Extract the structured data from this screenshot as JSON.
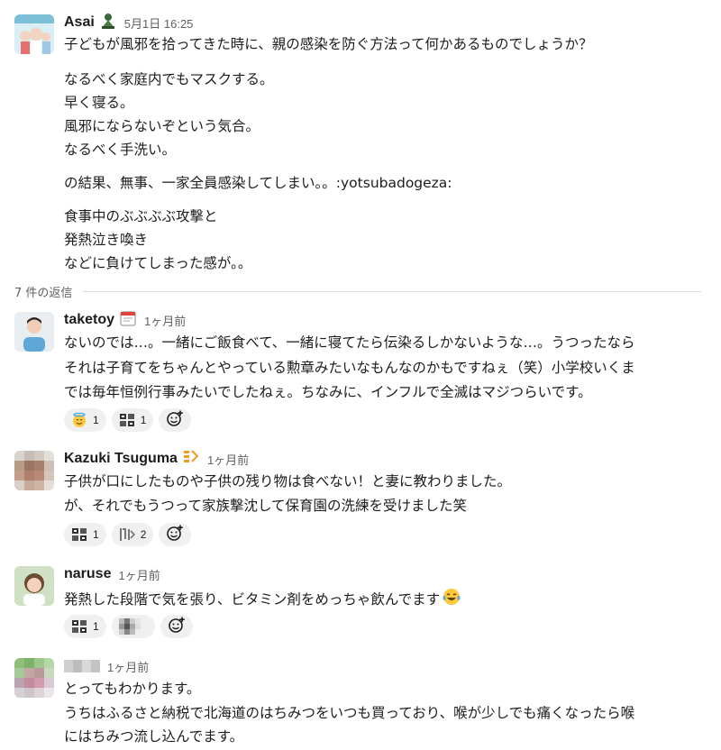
{
  "thread": {
    "parent": {
      "author": "Asai",
      "timestamp": "5月1日 16:25",
      "lines": [
        "子どもが風邪を拾ってきた時に、親の感染を防ぐ方法って何かあるものでしょうか？",
        "なるべく家庭内でもマスクする。",
        "早く寝る。",
        "風邪にならないぞという気合。",
        "なるべく手洗い。",
        "の結果、無事、一家全員感染してしまい。。:yotsubadogeza:",
        "食事中のぶぶぶぶ攻撃と",
        "発熱泣き喚き",
        "などに負けてしまった感が。。"
      ]
    },
    "replies_label": "7 件の返信",
    "replies": [
      {
        "author": "taketoy",
        "timestamp": "1ヶ月前",
        "lines": [
          "ないのでは…。一緒にご飯食べて、一緒に寝てたら伝染るしかないような…。うつったなら",
          "それは子育てをちゃんとやっている勲章みたいなもんなのかもですねぇ（笑）小学校いくま",
          "では毎年恒例行事みたいでしたねぇ。ちなみに、インフルで全滅はマジつらいです。"
        ],
        "reactions": [
          {
            "icon": "innocent-face-icon",
            "count": "1"
          },
          {
            "icon": "custom-stamp-icon",
            "count": "1"
          }
        ]
      },
      {
        "author": "Kazuki Tsuguma",
        "timestamp": "1ヶ月前",
        "lines": [
          "子供が口にしたものや子供の残り物は食べない！と妻に教わりました。",
          "が、それでもうつって家族撃沈して保育園の洗練を受けました笑"
        ],
        "reactions": [
          {
            "icon": "custom-stamp-icon",
            "count": "1"
          },
          {
            "icon": "custom-text-stamp-icon",
            "count": "2"
          }
        ]
      },
      {
        "author": "naruse",
        "timestamp": "1ヶ月前",
        "lines": [
          "発熱した段階で気を張り、ビタミン剤をめっちゃ飲んでます"
        ],
        "reactions": [
          {
            "icon": "custom-stamp-icon",
            "count": "1"
          },
          {
            "icon": "blurred-stamp-icon",
            "count": ""
          }
        ]
      },
      {
        "author": "",
        "timestamp": "1ヶ月前",
        "lines": [
          "とってもわかります。",
          "うちはふるさと納税で北海道のはちみつをいつも買っており、喉が少しでも痛くなったら喉",
          "にはちみつ流し込んでます。"
        ]
      }
    ]
  },
  "colors": {
    "text": "#1d1c1d",
    "muted": "#616061",
    "reaction_bg": "#f0f0f0",
    "divider": "#dddddd"
  }
}
